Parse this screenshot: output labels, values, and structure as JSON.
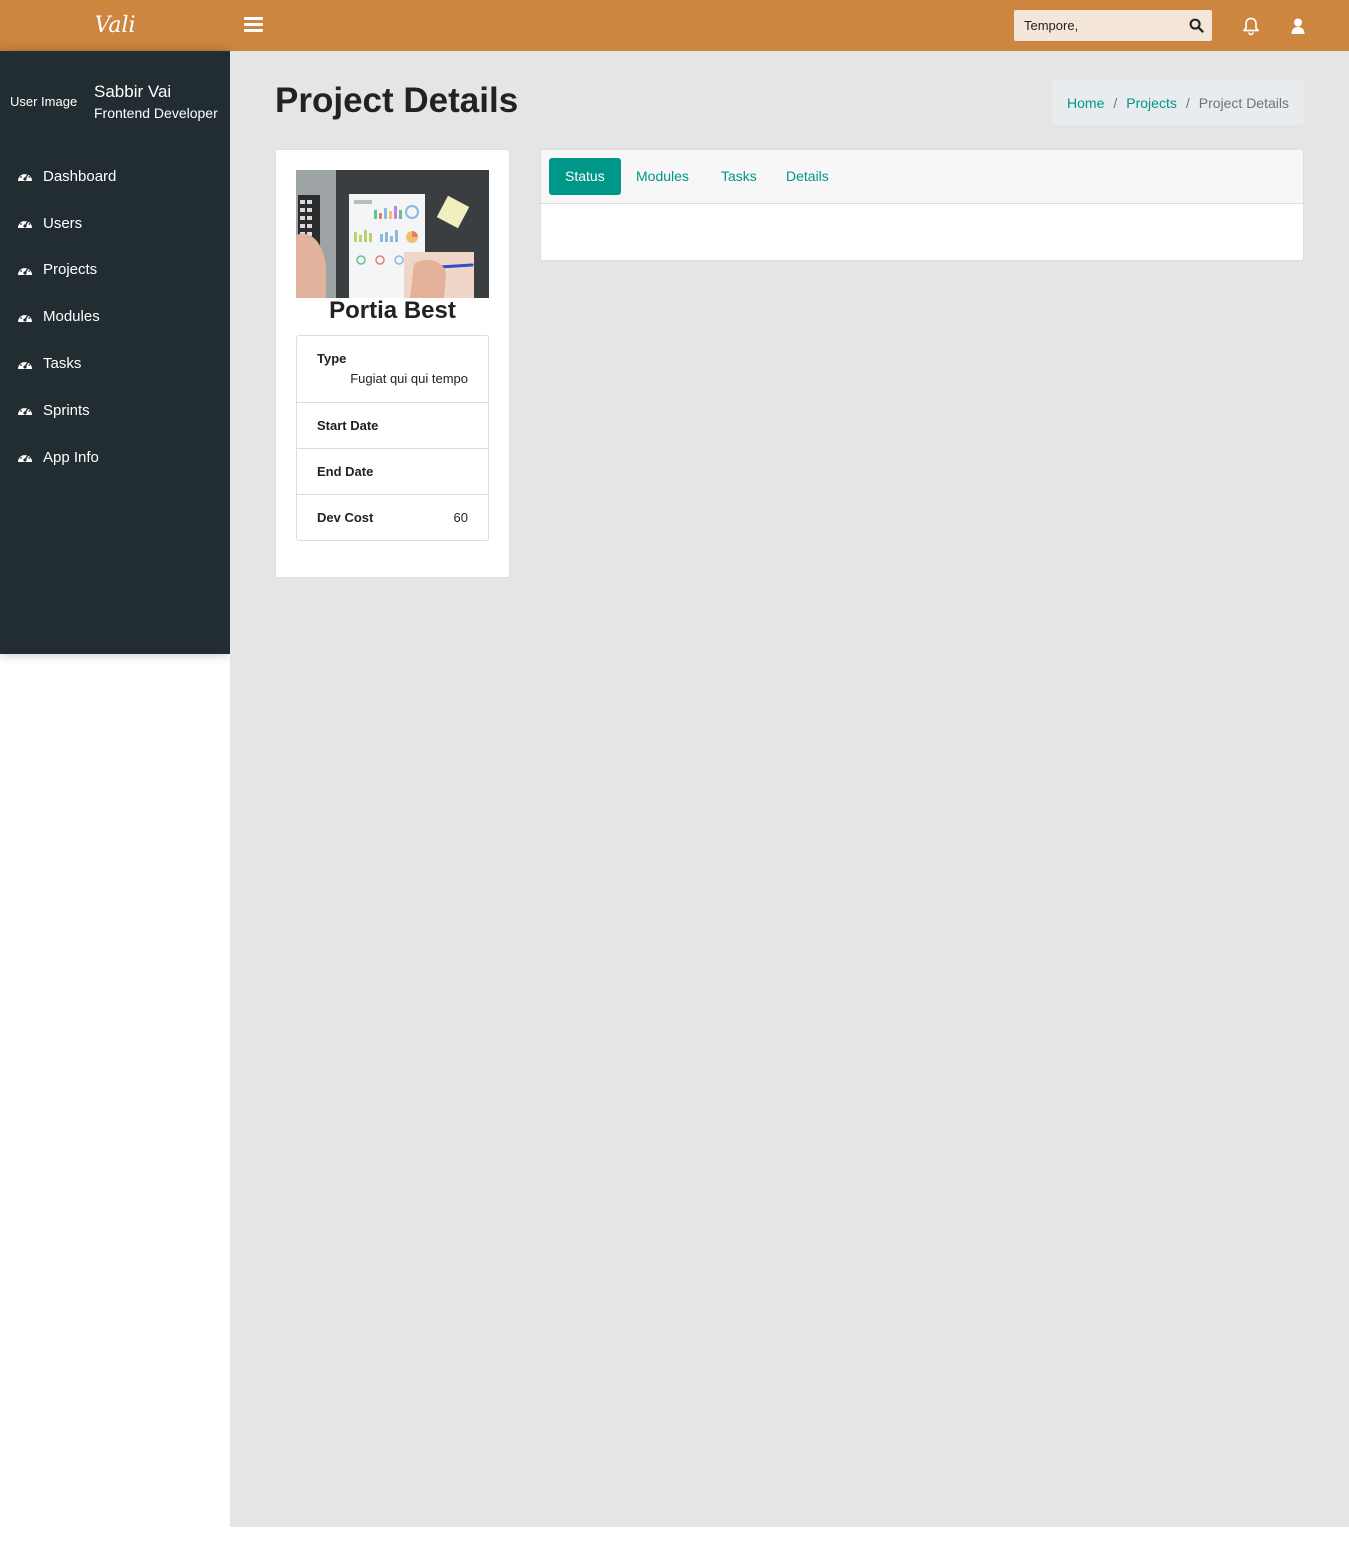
{
  "header": {
    "logo": "Vali",
    "search": {
      "value": "Tempore,"
    },
    "icons": {
      "menu": "menu-icon",
      "search": "search-icon",
      "notifications": "bell-icon",
      "user": "user-icon"
    }
  },
  "sidebar": {
    "user": {
      "image_alt": "User Image",
      "name": "Sabbir Vai",
      "role": "Frontend Developer"
    },
    "items": [
      {
        "label": "Dashboard",
        "icon": "dashboard-icon"
      },
      {
        "label": "Users",
        "icon": "dashboard-icon"
      },
      {
        "label": "Projects",
        "icon": "dashboard-icon"
      },
      {
        "label": "Modules",
        "icon": "dashboard-icon"
      },
      {
        "label": "Tasks",
        "icon": "dashboard-icon"
      },
      {
        "label": "Sprints",
        "icon": "dashboard-icon"
      },
      {
        "label": "App Info",
        "icon": "dashboard-icon"
      }
    ]
  },
  "page": {
    "title": "Project Details",
    "breadcrumb": {
      "home": "Home",
      "projects": "Projects",
      "current": "Project Details",
      "separator": "/"
    }
  },
  "project": {
    "name": "Portia Best",
    "type_label": "Type",
    "type_value": "Fugiat qui qui tempo",
    "start_label": "Start Date",
    "start_value": "",
    "end_label": "End Date",
    "end_value": "",
    "cost_label": "Dev Cost",
    "cost_value": "60"
  },
  "tabs": [
    {
      "label": "Status",
      "active": true
    },
    {
      "label": "Modules",
      "active": false
    },
    {
      "label": "Tasks",
      "active": false
    },
    {
      "label": "Details",
      "active": false
    }
  ],
  "colors": {
    "header": "#cd8640",
    "sidebar": "#222d32",
    "accent": "#009688",
    "content_bg": "#e5e5e5"
  }
}
